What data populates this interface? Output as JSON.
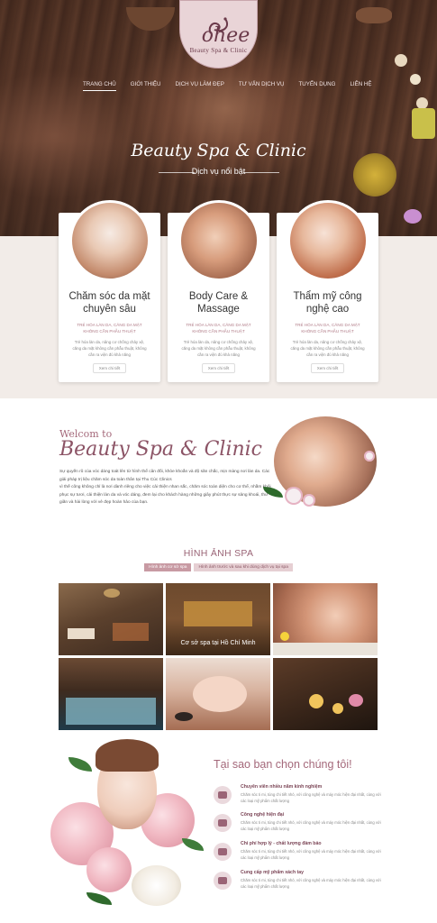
{
  "brand": {
    "name": "ohee",
    "subtitle": "Beauty Spa & Clinic"
  },
  "nav": {
    "items": [
      "TRANG CHỦ",
      "GIỚI THIỆU",
      "DỊCH VỤ LÀM ĐẸP",
      "TƯ VẤN DỊCH VỤ",
      "TUYỂN DỤNG",
      "LIÊN HỆ"
    ],
    "active_index": 0
  },
  "hero": {
    "title": "Beauty Spa & Clinic",
    "subtitle": "Dịch vụ nổi bật"
  },
  "services": [
    {
      "title": "Chăm sóc da mặt chuyên sâu",
      "tag": "TRẺ HÓA LÀN DA, CĂNG DA MẶT KHÔNG CẦN PHẪU THUẬT",
      "desc": "Trẻ hóa làn da, nâng cơ chống chảy xệ, căng da mặt không cần phẫu thuật, không cần ra viện đủ khả năng",
      "button": "Xem chi tiết"
    },
    {
      "title": "Body Care & Massage",
      "tag": "TRẺ HÓA LÀN DA, CĂNG DA MẶT KHÔNG CẦN PHẪU THUẬT",
      "desc": "Trẻ hóa làn da, nâng cơ chống chảy xệ, căng da mặt không cần phẫu thuật, không cần ra viện đủ khả năng",
      "button": "Xem chi tiết"
    },
    {
      "title": "Thẩm mỹ công nghệ cao",
      "tag": "TRẺ HÓA LÀN DA, CĂNG DA MẶT KHÔNG CẦN PHẪU THUẬT",
      "desc": "Trẻ hóa làn da, nâng cơ chống chảy xệ, căng da mặt không cần phẫu thuật, không cần ra viện đủ khả năng",
      "button": "Xem chi tiết"
    }
  ],
  "welcome": {
    "small": "Welcom to",
    "big": "Beauty Spa & Clinic",
    "text_1": "Sự quyến rũ của vóc dáng toát lên từ hình thể cân đối, khỏe khoắn và độ săn chắc, mịn màng nơi làn da. Các giải pháp trị liệu chăm sóc da toàn thân tại Thu Cúc Clinics",
    "text_2": "vì thế công không chỉ là nơi dành riêng cho việc cải thiện nhan sắc, chăm sóc toàn diện cho cơ thể, nhằm khôi phục sự tươi, cải thiện làn da và vóc dáng, đem lại cho khách hàng những giây phút thực sự sảng khoái, thư giãn và hài lòng với vẻ đẹp hoàn hảo của bạn."
  },
  "gallery": {
    "title": "HÌNH ẢNH SPA",
    "tabs": [
      "Hình ảnh cơ sở spa",
      "Hình ảnh trước và sau khi dùng dịch vụ tại spa"
    ],
    "active_tab": 0,
    "caption": "Cơ sở spa tại Hồ Chí Minh"
  },
  "why": {
    "title": "Tại sao bạn chọn chúng tôi!",
    "items": [
      {
        "head": "Chuyên viên nhiều năm kinh nghiệm",
        "desc": "Chăm sóc ti mi, tùng chi tiết nhỏ, với công nghệ và máy móc hiện đại nhất, cùng với các loại mỹ phẩm chất lượng"
      },
      {
        "head": "Công nghệ hiện đại",
        "desc": "Chăm sóc ti mi, tùng chi tiết nhỏ, với công nghệ và máy móc hiện đại nhất, cùng với các loại mỹ phẩm chất lượng"
      },
      {
        "head": "Chi phí hợp lý - chất lượng đảm bảo",
        "desc": "Chăm sóc ti mi, tùng chi tiết nhỏ, với công nghệ và máy móc hiện đại nhất, cùng với các loại mỹ phẩm chất lượng"
      },
      {
        "head": "Cung cấp mỹ phẩm xách tay",
        "desc": "Chăm sóc ti mi, tùng chi tiết nhỏ, với công nghệ và máy móc hiện đại nhất, cùng với các loại mỹ phẩm chất lượng"
      }
    ]
  },
  "colors": {
    "accent": "#a4687a",
    "accent_dark": "#7b4556",
    "hero_bg": "#4a2f22",
    "section_bg": "#f2ece8"
  }
}
